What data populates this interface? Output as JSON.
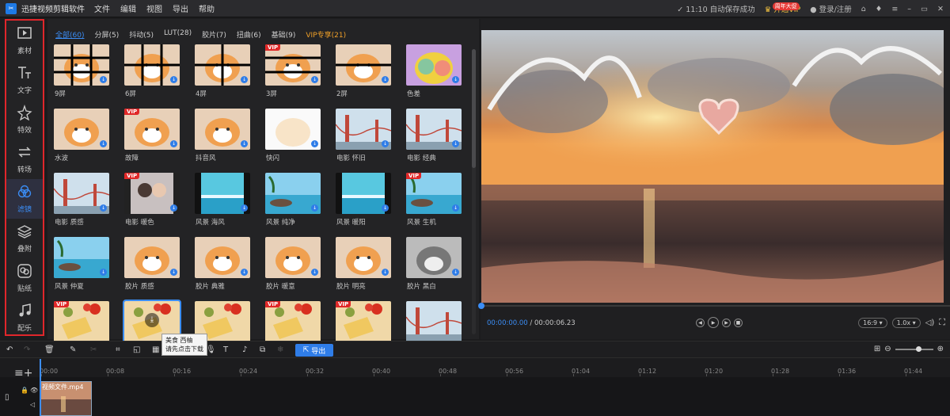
{
  "titlebar": {
    "app_name": "迅捷视频剪辑软件",
    "menu": [
      "文件",
      "编辑",
      "视图",
      "导出",
      "帮助"
    ],
    "autosave": "11:10 自动保存成功",
    "vip": "开通VIP",
    "vip_badge": "周年大促",
    "login": "登录/注册"
  },
  "sidebar": [
    {
      "label": "素材",
      "icon": "media-icon"
    },
    {
      "label": "文字",
      "icon": "text-icon"
    },
    {
      "label": "特效",
      "icon": "effects-icon"
    },
    {
      "label": "转场",
      "icon": "transition-icon"
    },
    {
      "label": "滤镜",
      "icon": "filter-icon",
      "active": true
    },
    {
      "label": "叠附",
      "icon": "overlay-icon"
    },
    {
      "label": "贴纸",
      "icon": "sticker-icon"
    },
    {
      "label": "配乐",
      "icon": "music-icon"
    }
  ],
  "tabs": [
    {
      "label": "全部(60)",
      "active": true
    },
    {
      "label": "分屏(5)"
    },
    {
      "label": "抖动(5)"
    },
    {
      "label": "LUT(28)"
    },
    {
      "label": "胶片(7)"
    },
    {
      "label": "扭曲(6)"
    },
    {
      "label": "基础(9)"
    },
    {
      "label": "VIP专享(21)",
      "vip": true
    }
  ],
  "filters": [
    {
      "label": "9屏",
      "thumb": "cat-grid9"
    },
    {
      "label": "6屏",
      "thumb": "cat-grid6"
    },
    {
      "label": "4屏",
      "thumb": "cat-grid4"
    },
    {
      "label": "3屏",
      "thumb": "cat-grid3",
      "vip": true
    },
    {
      "label": "2屏",
      "thumb": "cat-grid2"
    },
    {
      "label": "色差",
      "thumb": "cat-color"
    },
    {
      "label": "水波",
      "thumb": "cat"
    },
    {
      "label": "故障",
      "thumb": "cat",
      "vip": true
    },
    {
      "label": "抖音风",
      "thumb": "cat"
    },
    {
      "label": "快闪",
      "thumb": "cat-white"
    },
    {
      "label": "电影 怀旧",
      "thumb": "bridge"
    },
    {
      "label": "电影 经典",
      "thumb": "bridge"
    },
    {
      "label": "电影 质感",
      "thumb": "bridge"
    },
    {
      "label": "电影 暖色",
      "thumb": "couple",
      "vip": true
    },
    {
      "label": "风景 海风",
      "thumb": "sea"
    },
    {
      "label": "风景 纯净",
      "thumb": "beach"
    },
    {
      "label": "风景 暖阳",
      "thumb": "sea"
    },
    {
      "label": "风景 生机",
      "thumb": "beach",
      "vip": true
    },
    {
      "label": "风景 仲夏",
      "thumb": "beach"
    },
    {
      "label": "胶片 质感",
      "thumb": "cat"
    },
    {
      "label": "胶片 典雅",
      "thumb": "cat"
    },
    {
      "label": "胶片 暖意",
      "thumb": "cat"
    },
    {
      "label": "胶片 明亮",
      "thumb": "cat"
    },
    {
      "label": "胶片 黑白",
      "thumb": "cat-bw"
    },
    {
      "label": "",
      "thumb": "food",
      "vip": true
    },
    {
      "label": "",
      "thumb": "food",
      "selected": true
    },
    {
      "label": "",
      "thumb": "food"
    },
    {
      "label": "",
      "thumb": "food",
      "vip": true
    },
    {
      "label": "",
      "thumb": "food",
      "vip": true
    },
    {
      "label": "",
      "thumb": "bridge"
    }
  ],
  "tooltip": {
    "line1": "美食 西柚",
    "line2": "请先点击下载"
  },
  "preview": {
    "current_time": "00:00:00.00",
    "total_time": "/ 00:00:06.23",
    "ratio": "16:9",
    "speed": "1.0x",
    "progress": 0
  },
  "toolbar": {
    "export_label": "导出"
  },
  "ruler": [
    "00:00",
    "00:08",
    "00:16",
    "00:24",
    "00:32",
    "00:40",
    "00:48",
    "00:56",
    "01:04",
    "01:12",
    "01:20",
    "01:28",
    "01:36",
    "01:44"
  ],
  "clip": {
    "name": "视频文件.mp4"
  }
}
